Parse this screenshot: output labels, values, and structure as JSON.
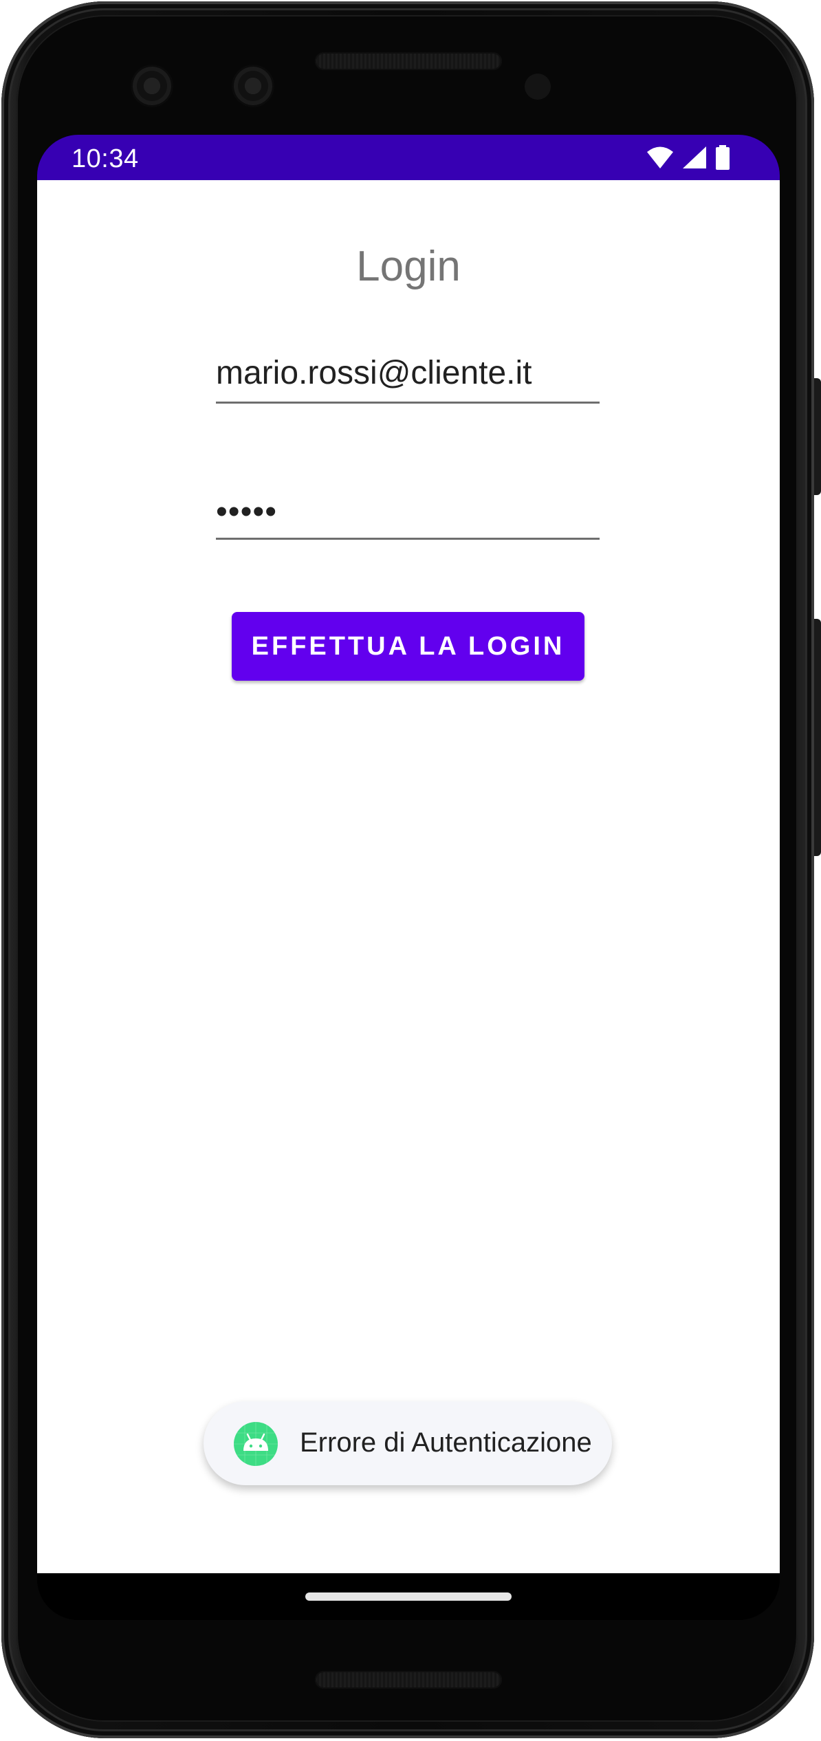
{
  "status_bar": {
    "time": "10:34",
    "icons": [
      "wifi-icon",
      "cell-signal-icon",
      "battery-icon"
    ],
    "color": "#3700b3"
  },
  "login": {
    "title": "Login",
    "email_value": "mario.rossi@cliente.it",
    "password_value": "•••••",
    "button_label": "EFFETTUA LA LOGIN",
    "button_color": "#6200ee"
  },
  "toast": {
    "icon": "android-icon",
    "message": "Errore di Autenticazione"
  }
}
